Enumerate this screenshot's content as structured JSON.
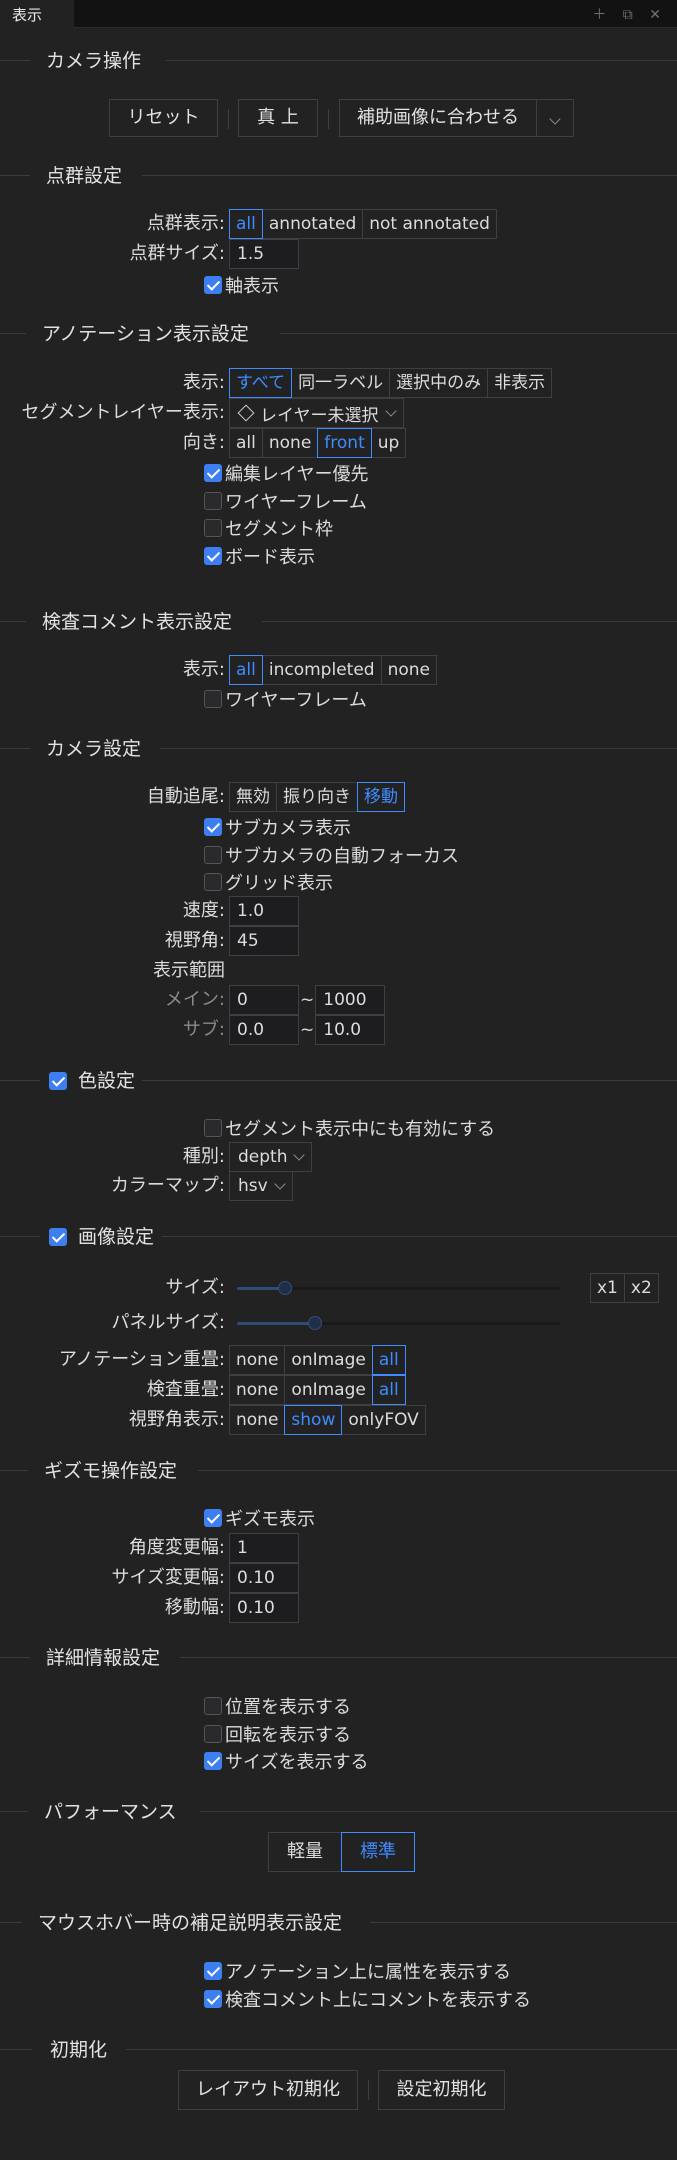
{
  "tab": {
    "title": "表示",
    "icons": "＋ ⧉ ✕"
  },
  "camera_ops": {
    "title": "カメラ操作",
    "reset": "リセット",
    "top": "真 上",
    "fit": "補助画像に合わせる"
  },
  "pointcloud": {
    "title": "点群設定",
    "display_label": "点群表示:",
    "display_options": [
      "all",
      "annotated",
      "not annotated"
    ],
    "display_selected": "all",
    "size_label": "点群サイズ:",
    "size_value": "1.5",
    "axis_label": "軸表示",
    "axis_checked": true
  },
  "annotation": {
    "title": "アノテーション表示設定",
    "display_label": "表示:",
    "display_options": [
      "すべて",
      "同一ラベル",
      "選択中のみ",
      "非表示"
    ],
    "display_selected": "すべて",
    "segment_label": "セグメントレイヤー表示:",
    "segment_value": "レイヤー未選択",
    "direction_label": "向き:",
    "direction_options": [
      "all",
      "none",
      "front",
      "up"
    ],
    "direction_selected": "front",
    "checks": [
      {
        "label": "編集レイヤー優先",
        "checked": true
      },
      {
        "label": "ワイヤーフレーム",
        "checked": false
      },
      {
        "label": "セグメント枠",
        "checked": false
      },
      {
        "label": "ボード表示",
        "checked": true
      }
    ]
  },
  "inspection": {
    "title": "検査コメント表示設定",
    "display_label": "表示:",
    "display_options": [
      "all",
      "incompleted",
      "none"
    ],
    "display_selected": "all",
    "wireframe_label": "ワイヤーフレーム",
    "wireframe_checked": false
  },
  "camera": {
    "title": "カメラ設定",
    "track_label": "自動追尾:",
    "track_options": [
      "無効",
      "振り向き",
      "移動"
    ],
    "track_selected": "移動",
    "checks": [
      {
        "label": "サブカメラ表示",
        "checked": true
      },
      {
        "label": "サブカメラの自動フォーカス",
        "checked": false
      },
      {
        "label": "グリッド表示",
        "checked": false
      }
    ],
    "speed_label": "速度:",
    "speed_value": "1.0",
    "fov_label": "視野角:",
    "fov_value": "45",
    "range_label": "表示範囲",
    "main_label": "メイン:",
    "main_min": "0",
    "main_max": "1000",
    "sub_label": "サブ:",
    "sub_min": "0.0",
    "sub_max": "10.0",
    "tilde": "~"
  },
  "color": {
    "title": "色設定",
    "enabled": true,
    "segment_label": "セグメント表示中にも有効にする",
    "segment_checked": false,
    "type_label": "種別:",
    "type_value": "depth",
    "colormap_label": "カラーマップ:",
    "colormap_value": "hsv"
  },
  "image": {
    "title": "画像設定",
    "enabled": true,
    "size_label": "サイズ:",
    "size_level": 0.15,
    "x1": "x1",
    "x2": "x2",
    "panel_label": "パネルサイズ:",
    "panel_level": 0.24,
    "overlay_label": "アノテーション重畳:",
    "overlay_options": [
      "none",
      "onImage",
      "all"
    ],
    "overlay_selected": "all",
    "inspection_label": "検査重畳:",
    "inspection_options": [
      "none",
      "onImage",
      "all"
    ],
    "inspection_selected": "all",
    "fov_label": "視野角表示:",
    "fov_options": [
      "none",
      "show",
      "onlyFOV"
    ],
    "fov_selected": "show"
  },
  "gizmo": {
    "title": "ギズモ操作設定",
    "show_label": "ギズモ表示",
    "show_checked": true,
    "angle_label": "角度変更幅:",
    "angle_value": "1",
    "size_label": "サイズ変更幅:",
    "size_value": "0.10",
    "move_label": "移動幅:",
    "move_value": "0.10"
  },
  "detail": {
    "title": "詳細情報設定",
    "checks": [
      {
        "label": "位置を表示する",
        "checked": false
      },
      {
        "label": "回転を表示する",
        "checked": false
      },
      {
        "label": "サイズを表示する",
        "checked": true
      }
    ]
  },
  "performance": {
    "title": "パフォーマンス",
    "options": [
      "軽量",
      "標準"
    ],
    "selected": "標準"
  },
  "hover": {
    "title": "マウスホバー時の補足説明表示設定",
    "checks": [
      {
        "label": "アノテーション上に属性を表示する",
        "checked": true
      },
      {
        "label": "検査コメント上にコメントを表示する",
        "checked": true
      }
    ]
  },
  "init": {
    "title": "初期化",
    "layout": "レイアウト初期化",
    "settings": "設定初期化"
  },
  "colors": {
    "bg": "#222223",
    "accent": "#3f8cff",
    "check": "#3d7ff0",
    "border": "#3f3f43"
  }
}
